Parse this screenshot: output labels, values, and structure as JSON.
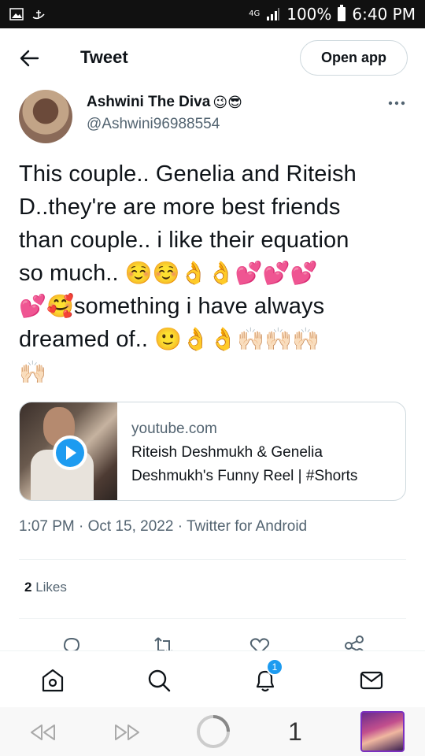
{
  "status_bar": {
    "network": "4G",
    "battery": "100%",
    "time": "6:40 PM"
  },
  "header": {
    "title": "Tweet",
    "open_app_label": "Open app"
  },
  "author": {
    "name": "Ashwini The Diva",
    "name_emojis": "😉😎",
    "handle": "@Ashwini96988554"
  },
  "tweet": {
    "line1": "This couple.. Genelia and Riteish",
    "line2": "D..they're are more best friends",
    "line3": "than couple.. i like their equation",
    "line4_text": "so much.. ",
    "line4_emoji": "☺️☺️👌👌💕💕💕",
    "line5_emoji": "💕🥰",
    "line5_text": "something i have always",
    "line6_text": "dreamed of.. ",
    "line6_emoji": "🙂👌👌🙌🏻🙌🏻🙌🏻",
    "line7_emoji": "🙌🏻"
  },
  "card": {
    "domain": "youtube.com",
    "title_line1": "Riteish Deshmukh & Genelia",
    "title_line2": "Deshmukh's Funny Reel | #Shorts"
  },
  "meta": {
    "timestamp": "1:07 PM · Oct 15, 2022 · Twitter for Android"
  },
  "stats": {
    "likes_count": "2",
    "likes_label": "Likes"
  },
  "tabs": {
    "notification_badge": "1"
  },
  "browser": {
    "tab_count": "1"
  },
  "colors": {
    "accent": "#1d9bf0",
    "text_primary": "#0f1419",
    "text_secondary": "#536471",
    "border": "#cfd9de"
  },
  "icons": [
    "back-arrow-icon",
    "more-icon",
    "reply-icon",
    "retweet-icon",
    "like-icon",
    "share-icon",
    "home-icon",
    "search-icon",
    "notifications-icon",
    "messages-icon",
    "rewind-icon",
    "forward-icon",
    "loading-icon"
  ]
}
